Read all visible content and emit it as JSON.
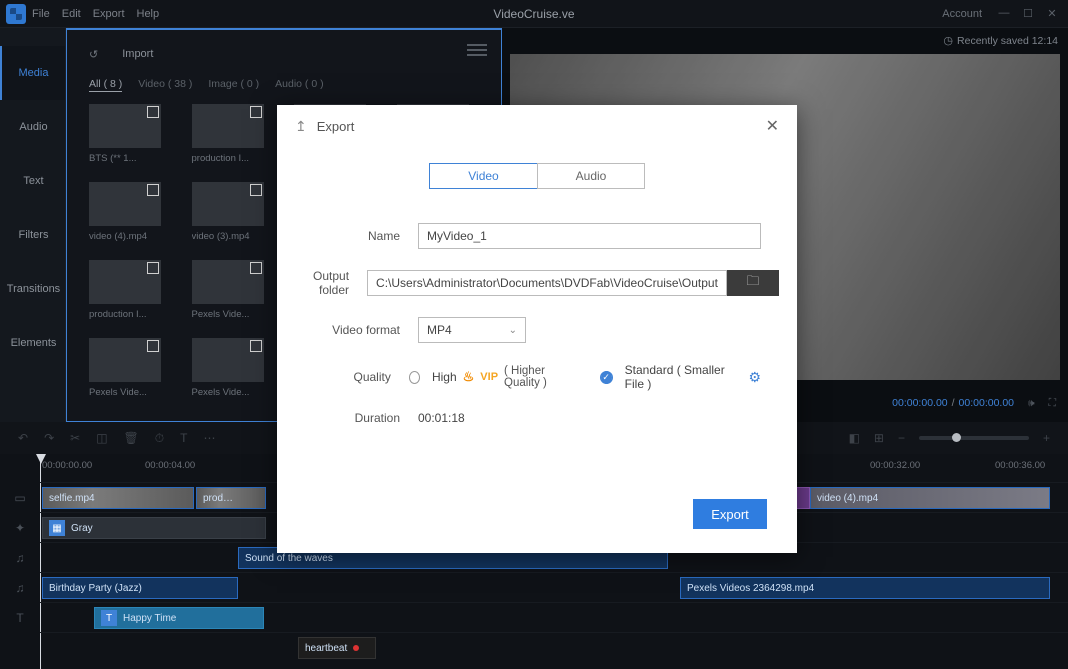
{
  "titlebar": {
    "menus": [
      "File",
      "Edit",
      "Export",
      "Help"
    ],
    "document": "VideoCruise.ve",
    "account": "Account",
    "recently_saved": "Recently saved 12:14"
  },
  "left_tabs": [
    "Media",
    "Audio",
    "Text",
    "Filters",
    "Transitions",
    "Elements"
  ],
  "media": {
    "home": "↺",
    "import": "Import",
    "filters": [
      "All ( 8 )",
      "Video ( 38 )",
      "Image ( 0 )",
      "Audio ( 0 )"
    ],
    "thumbs": [
      {
        "label": "BTS (** 1...",
        "cls": "tb-a"
      },
      {
        "label": "production I...",
        "cls": "tb-b"
      },
      {
        "label": "",
        "cls": "tb-c"
      },
      {
        "label": "",
        "cls": "tb-c"
      },
      {
        "label": "video (4).mp4",
        "cls": "tb-d"
      },
      {
        "label": "video (3).mp4",
        "cls": "tb-d"
      },
      {
        "label": "",
        "cls": "tb-c"
      },
      {
        "label": "",
        "cls": "tb-c"
      },
      {
        "label": "production I...",
        "cls": "tb-e"
      },
      {
        "label": "Pexels Vide...",
        "cls": "tb-e"
      },
      {
        "label": "",
        "cls": "tb-c"
      },
      {
        "label": "",
        "cls": "tb-c"
      },
      {
        "label": "Pexels Vide...",
        "cls": "tb-f"
      },
      {
        "label": "Pexels Vide...",
        "cls": "tb-f"
      },
      {
        "label": "",
        "cls": "tb-c"
      },
      {
        "label": "",
        "cls": "tb-c"
      }
    ]
  },
  "preview": {
    "time_current": "00:00:00.00",
    "time_total": "00:00:00.00"
  },
  "ruler": [
    "00:00:00.00",
    "00:00:04.00",
    "00:00:32.00",
    "00:00:36.00"
  ],
  "tracks": {
    "video1": {
      "label": "selfie.mp4",
      "extra": "prod…"
    },
    "video2": {
      "label": "video (4).mp4"
    },
    "fx": {
      "label": "Gray"
    },
    "music_wave": {
      "label": "Sound of the waves"
    },
    "music_jazz": {
      "label": "Birthday Party (Jazz)"
    },
    "pexels": {
      "label": "Pexels Videos 2364298.mp4"
    },
    "text": {
      "label": "Happy Time"
    },
    "heartbeat": {
      "label": "heartbeat"
    }
  },
  "export": {
    "title": "Export",
    "tabs": {
      "video": "Video",
      "audio": "Audio"
    },
    "labels": {
      "name": "Name",
      "output": "Output folder",
      "format": "Video format",
      "quality": "Quality",
      "duration": "Duration"
    },
    "name_value": "MyVideo_1",
    "output_value": "C:\\Users\\Administrator\\Documents\\DVDFab\\VideoCruise\\Output",
    "format_value": "MP4",
    "quality_high": "High",
    "quality_high_note": "( Higher Quality )",
    "quality_std": "Standard ( Smaller File )",
    "vip": "VIP",
    "duration_value": "00:01:18",
    "button": "Export"
  }
}
